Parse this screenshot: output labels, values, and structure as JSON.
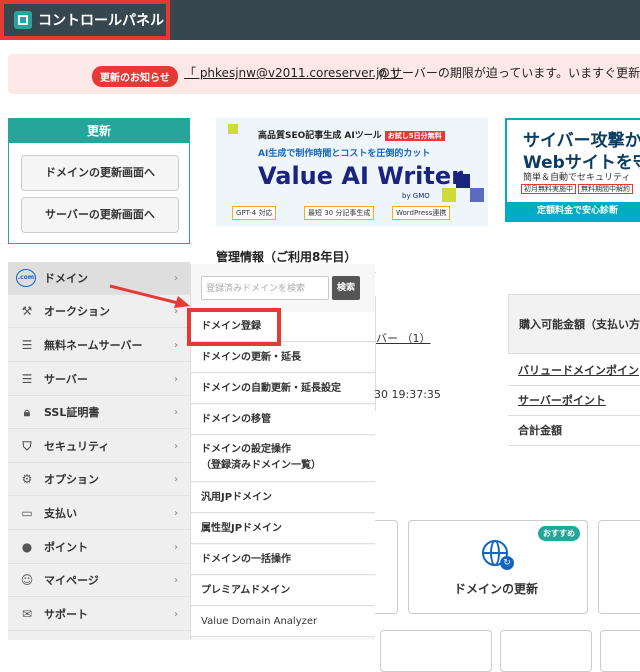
{
  "header": {
    "logo_text": "コントロールパネル"
  },
  "notice": {
    "badge": "更新のお知らせ",
    "link_text": "「 phkesjnw@v2011.coreserver.jp 」",
    "rest_text": "のサーバーの期限が迫っています。いますぐ更新し"
  },
  "update_box": {
    "title": "更新",
    "domain_button": "ドメインの更新画面へ",
    "server_button": "サーバーの更新画面へ"
  },
  "ad_ai_writer": {
    "line1": "高品質SEO記事生成 AIツール",
    "tag": "お試し5日分無料",
    "line2": "AI生成で制作時間とコストを圧倒的カット",
    "brand": "Value AI Writer",
    "brand_sub": "by GMO",
    "pills": [
      "GPT-4 対応",
      "最短 30 分記事生成",
      "WordPress連携"
    ]
  },
  "ad_security": {
    "line1": "サイバー攻撃か",
    "line2": "Webサイトを守",
    "line3": "簡単＆自動でセキュリティ",
    "tags": [
      "初月無料実施中",
      "無料期間中解約"
    ],
    "footer": "定額料金で安心診断"
  },
  "management": {
    "title": "管理情報（ご利用8年目）",
    "server_link": "バー （1）",
    "datetime": "30 19:37:35"
  },
  "right_table": {
    "rows": [
      "購入可能金額（支払い方",
      "バリュードメインポイン",
      "サーバーポイント",
      "合計金額"
    ]
  },
  "cards": {
    "recommend_badge": "おすすめ",
    "domain_renew_label": "ドメインの更新"
  },
  "sidebar": {
    "items": [
      {
        "label": "ドメイン",
        "icon": "com-icon"
      },
      {
        "label": "オークション",
        "icon": "hammer-icon"
      },
      {
        "label": "無料ネームサーバー",
        "icon": "server-icon"
      },
      {
        "label": "サーバー",
        "icon": "server-stack-icon"
      },
      {
        "label": "SSL証明書",
        "icon": "lock-icon"
      },
      {
        "label": "セキュリティ",
        "icon": "shield-icon"
      },
      {
        "label": "オプション",
        "icon": "gear-icon"
      },
      {
        "label": "支払い",
        "icon": "card-icon"
      },
      {
        "label": "ポイント",
        "icon": "piggy-icon"
      },
      {
        "label": "マイページ",
        "icon": "user-icon"
      },
      {
        "label": "サポート",
        "icon": "mail-icon"
      }
    ]
  },
  "flyout": {
    "search_placeholder": "登録済みドメインを検索",
    "search_button": "検索",
    "items": [
      {
        "label": "ドメイン登録"
      },
      {
        "label": "ドメインの更新・延長"
      },
      {
        "label": "ドメインの自動更新・延長設定"
      },
      {
        "label": "ドメインの移管"
      },
      {
        "label": "ドメインの設定操作",
        "sub": "（登録済みドメイン一覧）"
      },
      {
        "label": "汎用JPドメイン"
      },
      {
        "label": "属性型JPドメイン"
      },
      {
        "label": "ドメインの一括操作"
      },
      {
        "label": "プレミアムドメイン"
      },
      {
        "label": "Value Domain Analyzer"
      }
    ]
  },
  "colors": {
    "header_bg": "#37474f",
    "accent": "#26a69a",
    "highlight_red": "#e53935"
  }
}
